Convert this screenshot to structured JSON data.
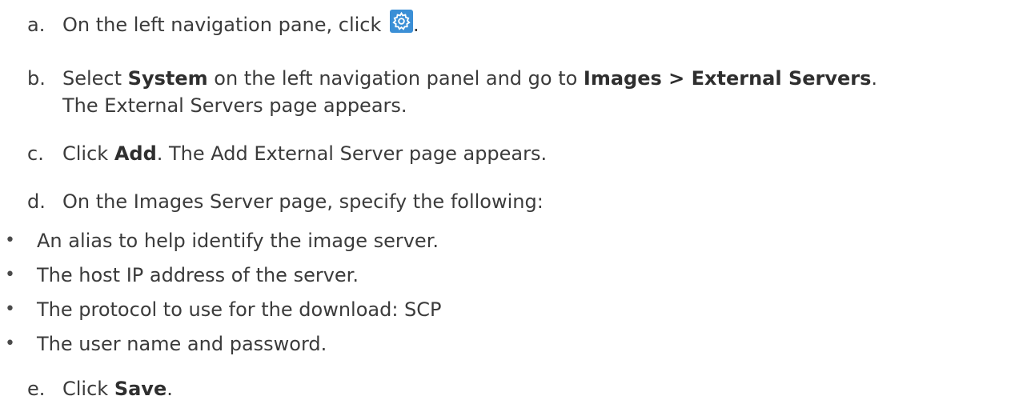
{
  "steps": [
    {
      "letter": "a.",
      "text_before": "On the left navigation pane, click",
      "text_after": "."
    },
    {
      "letter": "b.",
      "t1": "Select ",
      "b1": "System",
      "t2": " on the left navigation panel and go to ",
      "b2": "Images > External Servers",
      "t3": ".",
      "line2": "The External Servers page appears."
    },
    {
      "letter": "c.",
      "t1": "Click ",
      "b1": "Add",
      "t2": ". The Add External Server page appears."
    },
    {
      "letter": "d.",
      "text": "On the Images Server page, specify the following:"
    },
    {
      "letter": "e.",
      "t1": "Click ",
      "b1": "Save",
      "t2": "."
    }
  ],
  "bullets": {
    "symbol": "•",
    "items": [
      "An alias to help identify the image server.",
      "The host IP address of the server.",
      "The protocol to use for the download: SCP",
      "The user name and password."
    ]
  },
  "icons": {
    "settings": "gear-icon",
    "accent_color": "#3b8fd6"
  }
}
